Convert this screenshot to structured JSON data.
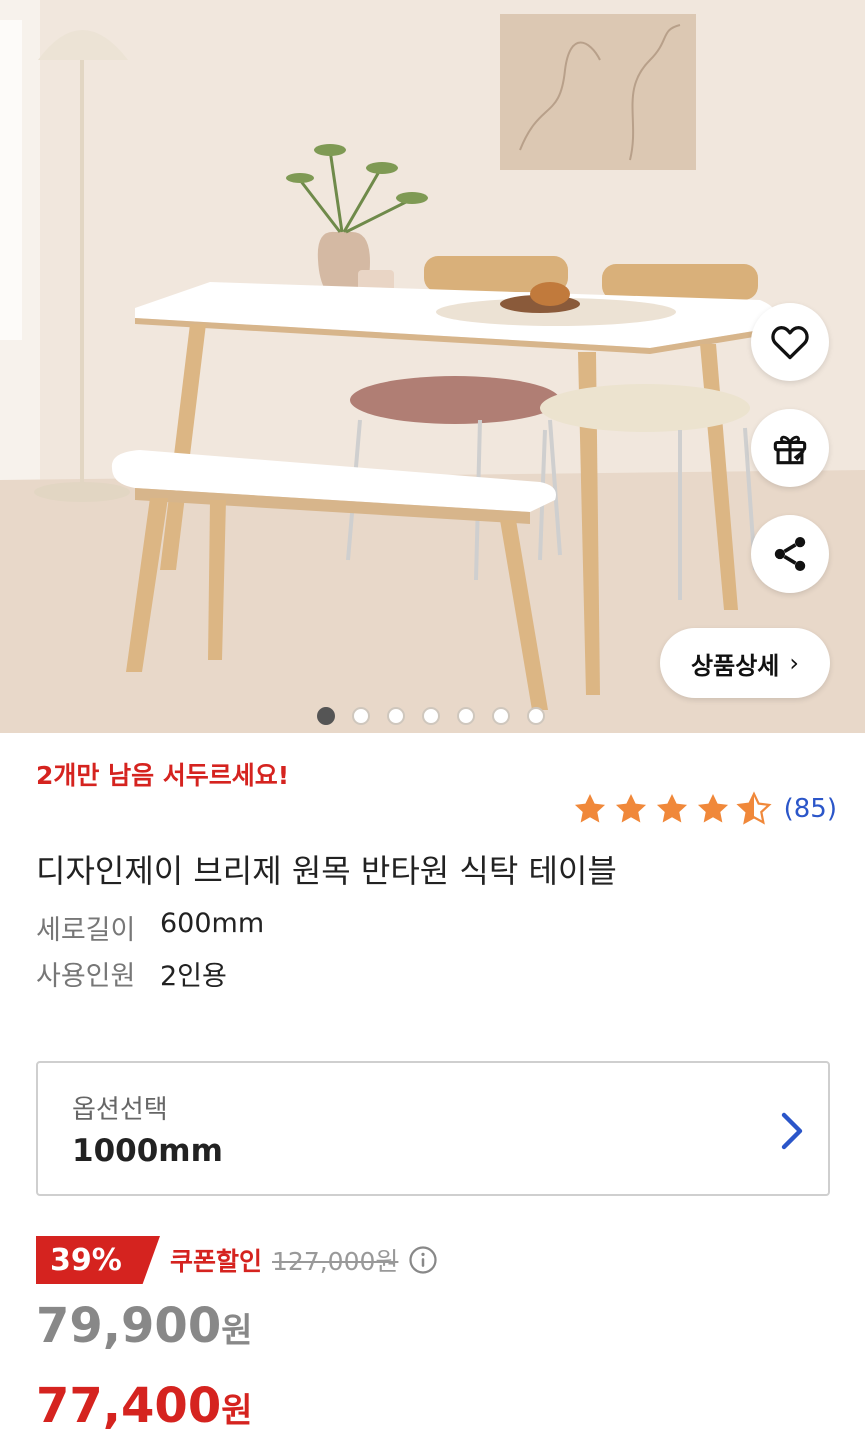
{
  "hero": {
    "slide_count": 7,
    "active_slide": 1,
    "detail_button_label": "상품상세",
    "detail_button_chevron": "›"
  },
  "actions": {
    "like_icon": "heart-icon",
    "gift_icon": "gift-icon",
    "share_icon": "share-icon"
  },
  "product": {
    "stock_notice": "2개만 남음 서두르세요!",
    "rating_value": 4.5,
    "review_count": "(85)",
    "name": "디자인제이 브리제 원목 반타원 식탁 테이블",
    "specs": [
      {
        "key": "세로길이",
        "value": "600mm"
      },
      {
        "key": "사용인원",
        "value": "2인용"
      }
    ]
  },
  "option": {
    "label": "옵션선택",
    "value": "1000mm"
  },
  "price": {
    "discount_rate": "39%",
    "coupon_label": "쿠폰할인",
    "original_price": "127,000원",
    "sale_price": "79,900",
    "final_price": "77,400",
    "currency": "원"
  },
  "colors": {
    "accent_red": "#d5231f",
    "link_blue": "#2b56c9",
    "star_orange": "#f0883a"
  }
}
